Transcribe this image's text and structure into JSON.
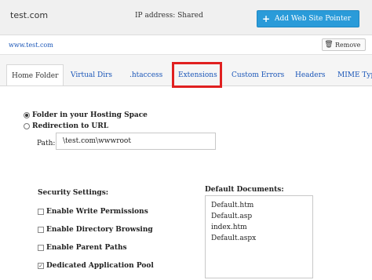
{
  "header": {
    "site_name": "test.com",
    "ip_label": "IP address: Shared",
    "add_pointer_label": "Add Web Site Pointer",
    "add_icon": "plus-icon"
  },
  "urlbar": {
    "url": "www.test.com",
    "remove_label": "Remove",
    "remove_icon": "trash-icon"
  },
  "tabs": [
    {
      "label": "Home Folder",
      "active": true
    },
    {
      "label": "Virtual Dirs"
    },
    {
      "label": ".htaccess"
    },
    {
      "label": "Extensions",
      "highlighted": true
    },
    {
      "label": "Custom Errors"
    },
    {
      "label": "Headers"
    },
    {
      "label": "MIME Types"
    }
  ],
  "home_folder": {
    "option_folder": "Folder in your Hosting Space",
    "option_redirect": "Redirection to URL",
    "selected_option": "folder",
    "path_label": "Path:",
    "path_value": "\\test.com\\wwwroot"
  },
  "security": {
    "title": "Security Settings:",
    "items": [
      {
        "label": "Enable Write Permissions",
        "checked": false
      },
      {
        "label": "Enable Directory Browsing",
        "checked": false
      },
      {
        "label": "Enable Parent Paths",
        "checked": false
      },
      {
        "label": "Dedicated Application Pool",
        "checked": true
      }
    ]
  },
  "documents": {
    "title": "Default Documents:",
    "items": [
      "Default.htm",
      "Default.asp",
      "index.htm",
      "Default.aspx"
    ]
  },
  "colors": {
    "accent": "#2a9bd9",
    "link": "#1a56b8",
    "highlight_border": "#e02020"
  }
}
